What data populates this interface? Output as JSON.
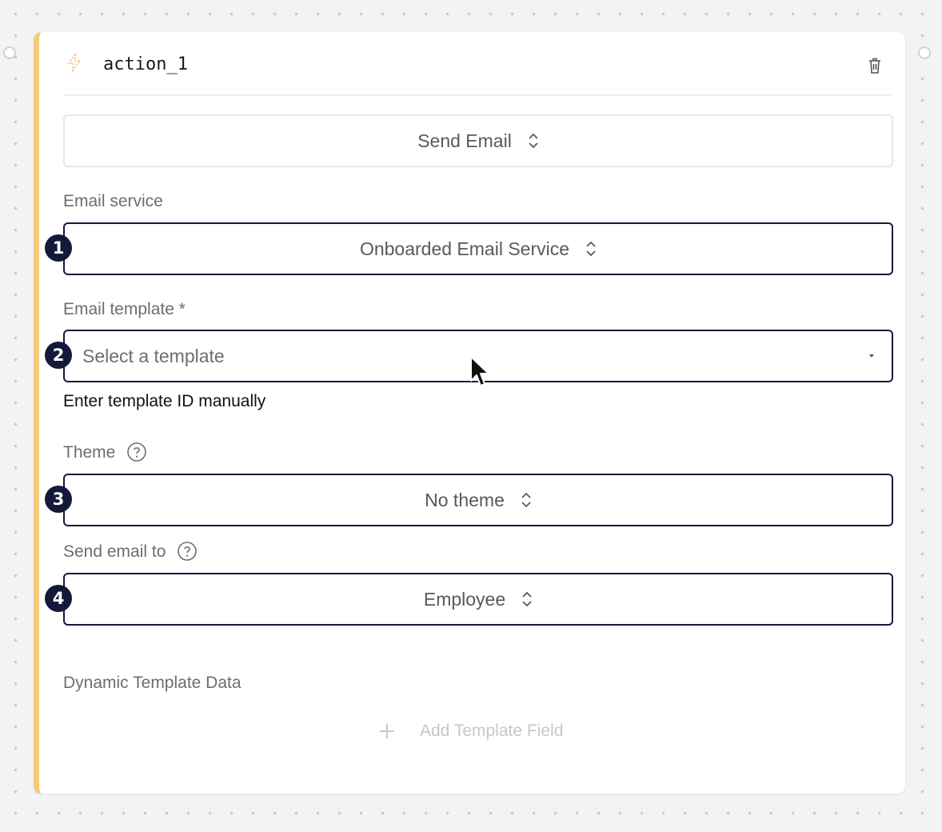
{
  "node": {
    "title": "action_1",
    "action_value": "Send Email"
  },
  "fields": {
    "email_service": {
      "label": "Email service",
      "value": "Onboarded Email Service"
    },
    "email_template": {
      "label": "Email template *",
      "placeholder": "Select a template",
      "manual_link": "Enter template ID manually"
    },
    "theme": {
      "label": "Theme",
      "value": "No theme"
    },
    "send_to": {
      "label": "Send email to",
      "value": "Employee"
    },
    "dynamic_data": {
      "label": "Dynamic Template Data",
      "add_button": "Add Template Field"
    }
  },
  "markers": [
    "1",
    "2",
    "3",
    "4"
  ],
  "colors": {
    "accent": "#f5c97a",
    "marker": "#14193a",
    "field_border": "#151a3a"
  },
  "icons": {
    "node": "bolt-icon",
    "delete": "trash-icon",
    "select": "chevron-up-down-icon",
    "help": "help-circle-icon",
    "add": "plus-icon"
  }
}
